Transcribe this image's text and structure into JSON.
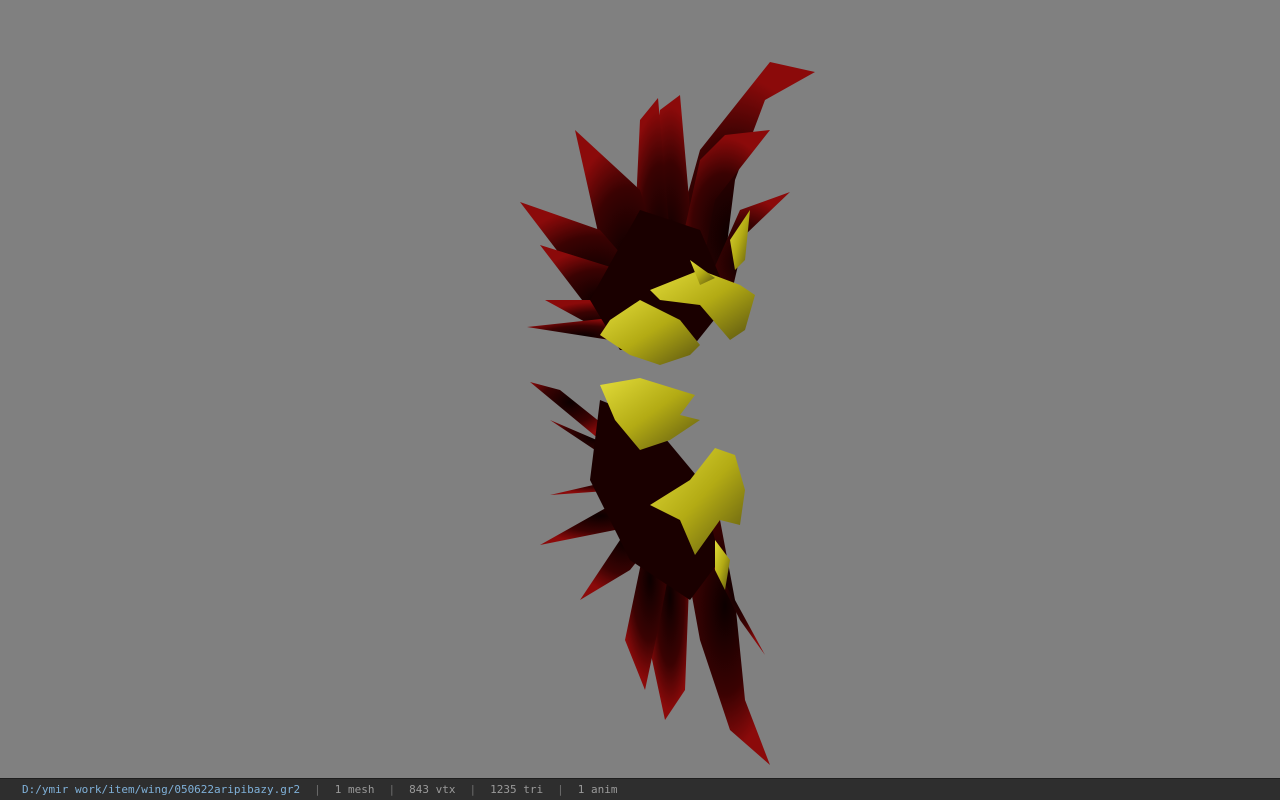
{
  "viewport": {
    "background": "#808080",
    "model": {
      "description_icon": "wing-model",
      "colors": {
        "feather_dark": "#1a0000",
        "feather_red": "#8b0a0a",
        "feather_edge": "#a01010",
        "gold": "#c9c21a",
        "gold_dark": "#5a5410"
      }
    }
  },
  "statusbar": {
    "file_path": "D:/ymir work/item/wing/050622aripibazy.gr2",
    "mesh_count": "1 mesh",
    "vertex_count": "843 vtx",
    "triangle_count": "1235 tri",
    "anim_count": "1 anim",
    "separator": "|"
  }
}
